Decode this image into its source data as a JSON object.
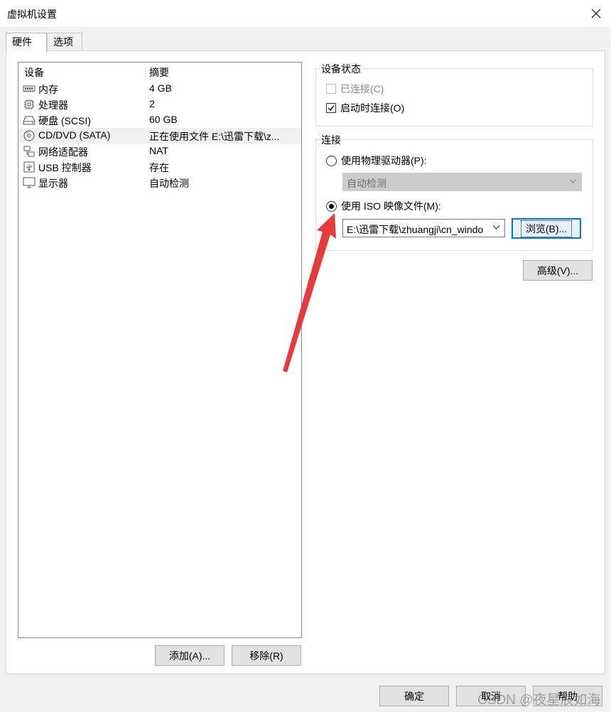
{
  "window": {
    "title": "虚拟机设置",
    "close_glyph": "✕"
  },
  "tabs": [
    {
      "label": "硬件",
      "active": true
    },
    {
      "label": "选项",
      "active": false
    }
  ],
  "device_list": {
    "columns": [
      "设备",
      "摘要"
    ],
    "rows": [
      {
        "name": "内存",
        "summary": "4 GB",
        "icon": "memory-icon"
      },
      {
        "name": "处理器",
        "summary": "2",
        "icon": "processor-icon"
      },
      {
        "name": "硬盘 (SCSI)",
        "summary": "60 GB",
        "icon": "hard-disk-icon"
      },
      {
        "name": "CD/DVD (SATA)",
        "summary": "正在使用文件 E:\\迅雷下载\\z...",
        "icon": "cd-dvd-icon",
        "selected": true
      },
      {
        "name": "网络适配器",
        "summary": "NAT",
        "icon": "network-adapter-icon"
      },
      {
        "name": "USB 控制器",
        "summary": "存在",
        "icon": "usb-icon"
      },
      {
        "name": "显示器",
        "summary": "自动检测",
        "icon": "display-icon"
      }
    ],
    "add_button": "添加(A)...",
    "remove_button": "移除(R)"
  },
  "device_status": {
    "title": "设备状态",
    "connected": {
      "label": "已连接(C)",
      "checked": false,
      "disabled": true
    },
    "connect_on_power": {
      "label": "启动时连接(O)",
      "checked": true
    }
  },
  "connection": {
    "title": "连接",
    "physical_drive": {
      "label": "使用物理驱动器(P):",
      "selected": false
    },
    "physical_drive_select": "自动检测",
    "iso_file": {
      "label": "使用 ISO 映像文件(M):",
      "selected": true
    },
    "iso_path": "E:\\迅雷下载\\zhuangji\\cn_windo",
    "browse_button": "浏览(B)..."
  },
  "advanced_button": "高级(V)...",
  "footer": {
    "ok_button": "确定",
    "cancel_button": "取消",
    "help_button": "帮助"
  },
  "watermark": "CSDN @夜星辰如海",
  "colors": {
    "annotation_arrow": "#e8393b",
    "focus_blue": "#0078d7",
    "selected_row": "#f0f0f0"
  }
}
